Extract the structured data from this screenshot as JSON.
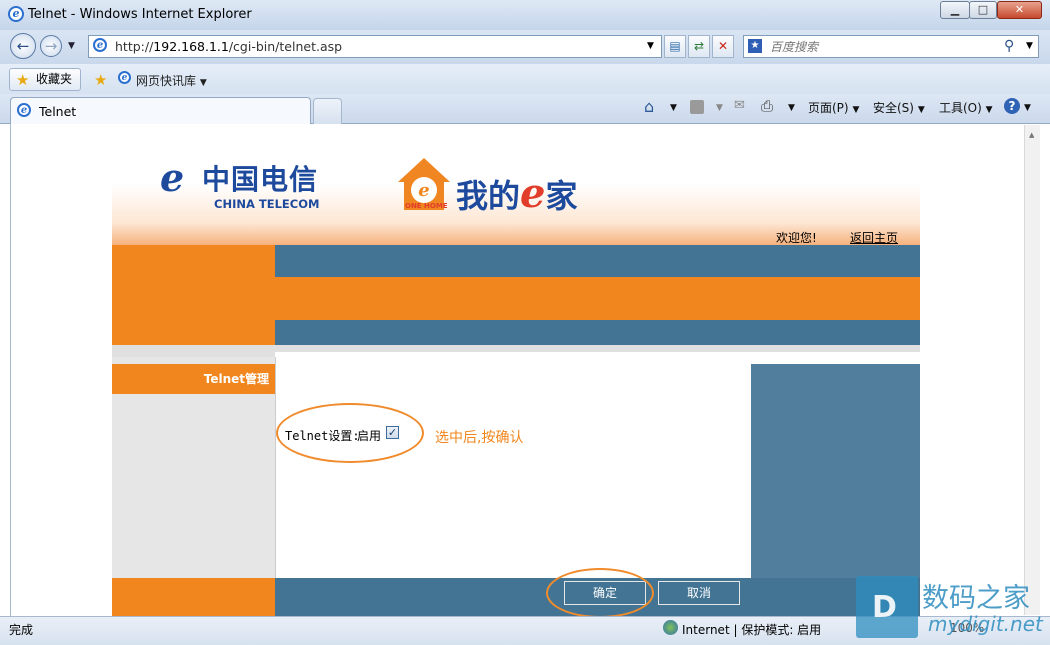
{
  "window": {
    "title": "Telnet - Windows Internet Explorer",
    "minimize": "▁",
    "maximize": "□",
    "close": "✕"
  },
  "address_bar": {
    "url_prefix": "http://",
    "url_host": "192.168.1.1",
    "url_path": "/cgi-bin/telnet.asp",
    "search_placeholder": "百度搜索"
  },
  "favorites_bar": {
    "favorites_label": "收藏夹",
    "quick_library_label": "网页快讯库"
  },
  "tabs": [
    {
      "label": "Telnet"
    }
  ],
  "command_bar": {
    "page_label": "页面(P)",
    "safety_label": "安全(S)",
    "tools_label": "工具(O)"
  },
  "banner": {
    "brand_cn": "中国电信",
    "brand_en": "CHINA TELECOM",
    "product_prefix": "我的",
    "product_e": "e",
    "product_suffix": "家",
    "house_tag": "ONE HOME",
    "welcome": "欢迎您!",
    "home_link": "返回主页"
  },
  "sidebar": {
    "active_item": "Telnet管理"
  },
  "form": {
    "telnet_label": "Telnet设置:",
    "enable_label": "启用",
    "enable_checked": true,
    "annotation": "选中后,按确认",
    "ok_button": "确定",
    "cancel_button": "取消"
  },
  "status_bar": {
    "status": "完成",
    "zone": "Internet | 保护模式: 启用",
    "zoom": "100%"
  },
  "watermark": {
    "name": "数码之家",
    "url": "mydigit.net"
  },
  "colors": {
    "accent_orange": "#f0861d",
    "steel_blue": "#437493",
    "brand_blue": "#1d4a9c"
  }
}
